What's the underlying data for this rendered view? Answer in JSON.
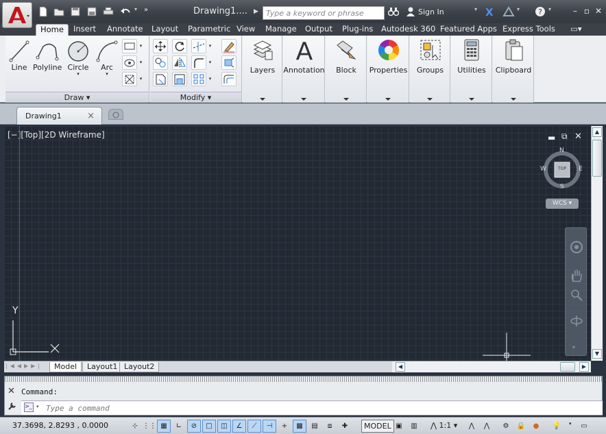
{
  "titlebar": {
    "doc_title": "Drawing1....",
    "search_placeholder": "Type a keyword or phrase",
    "signin_label": "Sign In"
  },
  "ribbon_tabs": [
    "Home",
    "Insert",
    "Annotate",
    "Layout",
    "Parametric",
    "View",
    "Manage",
    "Output",
    "Plug-ins",
    "Autodesk 360",
    "Featured Apps",
    "Express Tools"
  ],
  "draw_panel": {
    "title": "Draw",
    "tools": [
      "Line",
      "Polyline",
      "Circle",
      "Arc"
    ]
  },
  "modify_panel": {
    "title": "Modify"
  },
  "big_panels": [
    "Layers",
    "Annotation",
    "Block",
    "Properties",
    "Groups",
    "Utilities",
    "Clipboard"
  ],
  "file_tab": {
    "label": "Drawing1",
    "close": "×"
  },
  "viewport": {
    "label": "[−][Top][2D Wireframe]",
    "viewcube": {
      "n": "N",
      "s": "S",
      "e": "E",
      "w": "W",
      "face": "TOP",
      "wcs": "WCS"
    },
    "ucs_y": "Y",
    "ucs_x": "X"
  },
  "layout_tabs": [
    "Model",
    "Layout1",
    "Layout2"
  ],
  "command": {
    "history": "Command:",
    "placeholder": "Type a command"
  },
  "status": {
    "coords": "37.3698, 2.8293 , 0.0000",
    "model_label": "MODEL",
    "scale": "1:1"
  },
  "colors": {
    "canvas_bg": "#222933",
    "app_red": "#c0161b",
    "active_toggle": "#b9d7f5"
  }
}
